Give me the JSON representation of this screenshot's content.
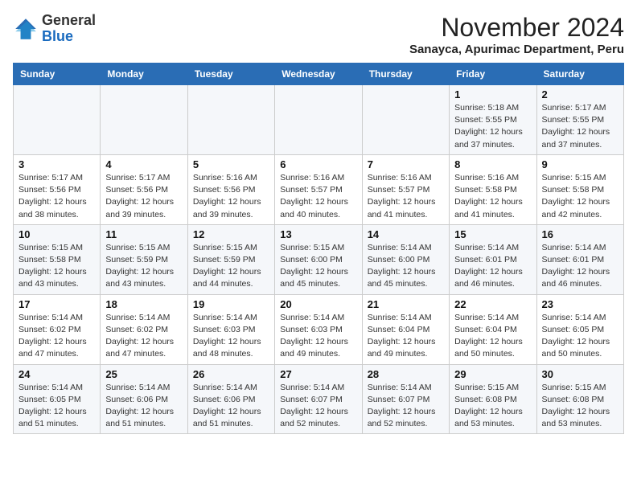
{
  "header": {
    "logo": {
      "general": "General",
      "blue": "Blue"
    },
    "month_title": "November 2024",
    "subtitle": "Sanayca, Apurimac Department, Peru"
  },
  "days_of_week": [
    "Sunday",
    "Monday",
    "Tuesday",
    "Wednesday",
    "Thursday",
    "Friday",
    "Saturday"
  ],
  "weeks": [
    [
      {
        "day": "",
        "info": ""
      },
      {
        "day": "",
        "info": ""
      },
      {
        "day": "",
        "info": ""
      },
      {
        "day": "",
        "info": ""
      },
      {
        "day": "",
        "info": ""
      },
      {
        "day": "1",
        "info": "Sunrise: 5:18 AM\nSunset: 5:55 PM\nDaylight: 12 hours\nand 37 minutes."
      },
      {
        "day": "2",
        "info": "Sunrise: 5:17 AM\nSunset: 5:55 PM\nDaylight: 12 hours\nand 37 minutes."
      }
    ],
    [
      {
        "day": "3",
        "info": "Sunrise: 5:17 AM\nSunset: 5:56 PM\nDaylight: 12 hours\nand 38 minutes."
      },
      {
        "day": "4",
        "info": "Sunrise: 5:17 AM\nSunset: 5:56 PM\nDaylight: 12 hours\nand 39 minutes."
      },
      {
        "day": "5",
        "info": "Sunrise: 5:16 AM\nSunset: 5:56 PM\nDaylight: 12 hours\nand 39 minutes."
      },
      {
        "day": "6",
        "info": "Sunrise: 5:16 AM\nSunset: 5:57 PM\nDaylight: 12 hours\nand 40 minutes."
      },
      {
        "day": "7",
        "info": "Sunrise: 5:16 AM\nSunset: 5:57 PM\nDaylight: 12 hours\nand 41 minutes."
      },
      {
        "day": "8",
        "info": "Sunrise: 5:16 AM\nSunset: 5:58 PM\nDaylight: 12 hours\nand 41 minutes."
      },
      {
        "day": "9",
        "info": "Sunrise: 5:15 AM\nSunset: 5:58 PM\nDaylight: 12 hours\nand 42 minutes."
      }
    ],
    [
      {
        "day": "10",
        "info": "Sunrise: 5:15 AM\nSunset: 5:58 PM\nDaylight: 12 hours\nand 43 minutes."
      },
      {
        "day": "11",
        "info": "Sunrise: 5:15 AM\nSunset: 5:59 PM\nDaylight: 12 hours\nand 43 minutes."
      },
      {
        "day": "12",
        "info": "Sunrise: 5:15 AM\nSunset: 5:59 PM\nDaylight: 12 hours\nand 44 minutes."
      },
      {
        "day": "13",
        "info": "Sunrise: 5:15 AM\nSunset: 6:00 PM\nDaylight: 12 hours\nand 45 minutes."
      },
      {
        "day": "14",
        "info": "Sunrise: 5:14 AM\nSunset: 6:00 PM\nDaylight: 12 hours\nand 45 minutes."
      },
      {
        "day": "15",
        "info": "Sunrise: 5:14 AM\nSunset: 6:01 PM\nDaylight: 12 hours\nand 46 minutes."
      },
      {
        "day": "16",
        "info": "Sunrise: 5:14 AM\nSunset: 6:01 PM\nDaylight: 12 hours\nand 46 minutes."
      }
    ],
    [
      {
        "day": "17",
        "info": "Sunrise: 5:14 AM\nSunset: 6:02 PM\nDaylight: 12 hours\nand 47 minutes."
      },
      {
        "day": "18",
        "info": "Sunrise: 5:14 AM\nSunset: 6:02 PM\nDaylight: 12 hours\nand 47 minutes."
      },
      {
        "day": "19",
        "info": "Sunrise: 5:14 AM\nSunset: 6:03 PM\nDaylight: 12 hours\nand 48 minutes."
      },
      {
        "day": "20",
        "info": "Sunrise: 5:14 AM\nSunset: 6:03 PM\nDaylight: 12 hours\nand 49 minutes."
      },
      {
        "day": "21",
        "info": "Sunrise: 5:14 AM\nSunset: 6:04 PM\nDaylight: 12 hours\nand 49 minutes."
      },
      {
        "day": "22",
        "info": "Sunrise: 5:14 AM\nSunset: 6:04 PM\nDaylight: 12 hours\nand 50 minutes."
      },
      {
        "day": "23",
        "info": "Sunrise: 5:14 AM\nSunset: 6:05 PM\nDaylight: 12 hours\nand 50 minutes."
      }
    ],
    [
      {
        "day": "24",
        "info": "Sunrise: 5:14 AM\nSunset: 6:05 PM\nDaylight: 12 hours\nand 51 minutes."
      },
      {
        "day": "25",
        "info": "Sunrise: 5:14 AM\nSunset: 6:06 PM\nDaylight: 12 hours\nand 51 minutes."
      },
      {
        "day": "26",
        "info": "Sunrise: 5:14 AM\nSunset: 6:06 PM\nDaylight: 12 hours\nand 51 minutes."
      },
      {
        "day": "27",
        "info": "Sunrise: 5:14 AM\nSunset: 6:07 PM\nDaylight: 12 hours\nand 52 minutes."
      },
      {
        "day": "28",
        "info": "Sunrise: 5:14 AM\nSunset: 6:07 PM\nDaylight: 12 hours\nand 52 minutes."
      },
      {
        "day": "29",
        "info": "Sunrise: 5:15 AM\nSunset: 6:08 PM\nDaylight: 12 hours\nand 53 minutes."
      },
      {
        "day": "30",
        "info": "Sunrise: 5:15 AM\nSunset: 6:08 PM\nDaylight: 12 hours\nand 53 minutes."
      }
    ]
  ]
}
